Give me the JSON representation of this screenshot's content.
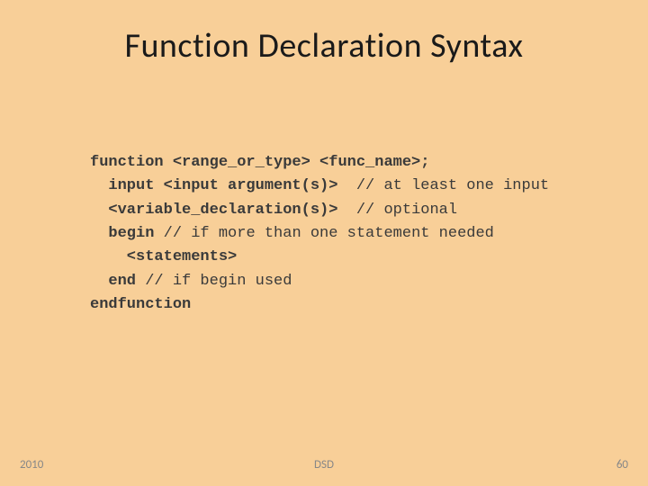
{
  "slide": {
    "title": "Function Declaration Syntax",
    "footer_left": "2010",
    "footer_center": "DSD",
    "footer_right": "60"
  },
  "code": {
    "l1a": "function <range_or_type> <func_name>;",
    "l2a": "  input <input argument(s)>  ",
    "l2b": "// at least one input",
    "l3a": "  <variable_declaration(s)>  ",
    "l3b": "// optional",
    "l4a": "  begin ",
    "l4b": "// if more than one statement needed",
    "l5a": "    <statements>",
    "l6a": "  end ",
    "l6b": "// if begin used",
    "l7a": "endfunction"
  }
}
